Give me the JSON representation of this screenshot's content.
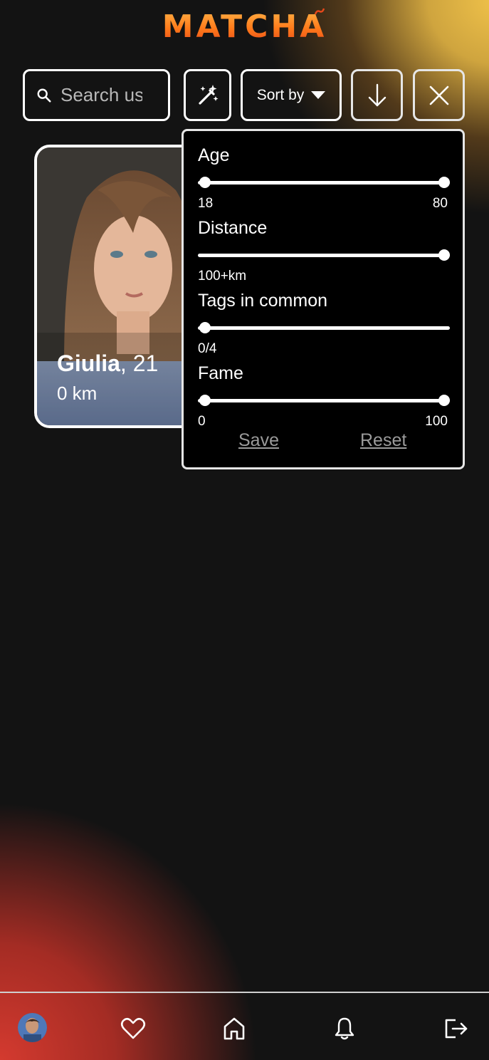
{
  "app": {
    "logo_text": "MATCHA"
  },
  "toolbar": {
    "search_placeholder": "Search users",
    "sort_label": "Sort by",
    "icons": {
      "search": "search-icon",
      "magic": "magic-wand-icon",
      "sort_caret": "caret-down-icon",
      "order": "arrow-down-icon",
      "close": "close-icon"
    }
  },
  "card": {
    "name": "Giulia",
    "age_text": ", 21",
    "distance": "0 km"
  },
  "filters": {
    "age": {
      "label": "Age",
      "min": "18",
      "max": "80",
      "range": [
        0,
        1
      ]
    },
    "distance": {
      "label": "Distance",
      "value": "100+km",
      "level": 1
    },
    "tags": {
      "label": "Tags in common",
      "value": "0/4",
      "level": 0
    },
    "fame": {
      "label": "Fame",
      "min": "0",
      "max": "100",
      "range": [
        0,
        1
      ]
    },
    "save_label": "Save",
    "reset_label": "Reset"
  },
  "nav": {
    "items": [
      "avatar",
      "heart-icon",
      "home-icon",
      "bell-icon",
      "logout-icon"
    ]
  },
  "colors": {
    "background": "#131313",
    "accent_yellow": "#f0c24a",
    "accent_red": "#d43a2f",
    "logo_orange": "#ff7a1a",
    "panel": "#000000",
    "link_gray": "#9a9a9a"
  }
}
